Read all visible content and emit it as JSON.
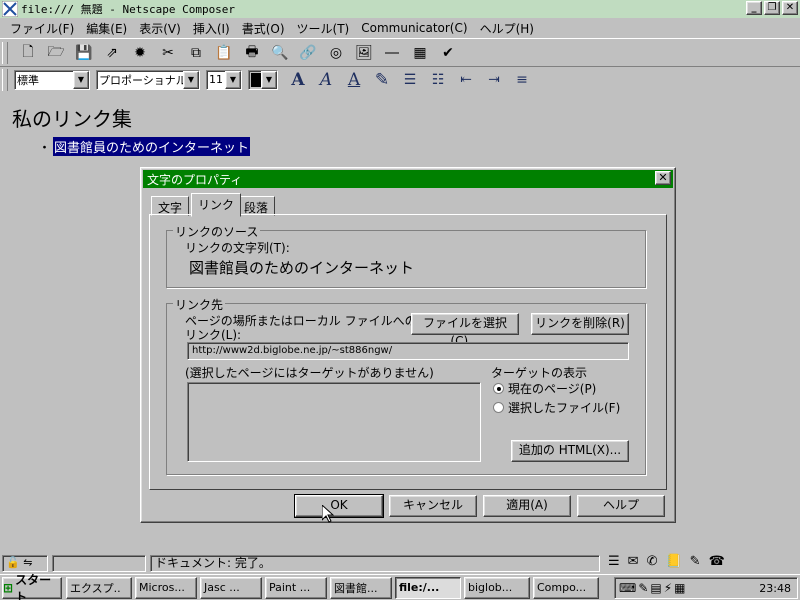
{
  "window": {
    "title": "file:/// 無題 - Netscape Composer"
  },
  "menubar": {
    "items": [
      "ファイル(F)",
      "編集(E)",
      "表示(V)",
      "挿入(I)",
      "書式(O)",
      "ツール(T)",
      "Communicator(C)",
      "ヘルプ(H)"
    ]
  },
  "format_bar": {
    "paragraph_style": "標準",
    "font": "プロポーショナル",
    "font_size": "11",
    "text_color": "#000000"
  },
  "document": {
    "heading": "私のリンク集",
    "bullet": "・",
    "link_text": "図書館員のためのインターネット"
  },
  "dialog": {
    "title": "文字のプロパティ",
    "tabs": [
      "文字",
      "リンク",
      "段落"
    ],
    "active_tab": "リンク",
    "source_group": "リンクのソース",
    "source_label": "リンクの文字列(T):",
    "source_text": "図書館員のためのインターネット",
    "dest_group": "リンク先",
    "dest_label_1": "ページの場所またはローカル ファイルへの",
    "dest_label_2": "リンク(L):",
    "choose_file": "ファイルを選択(C)...",
    "remove_link": "リンクを削除(R)",
    "url": "http://www2d.biglobe.ne.jp/~st886ngw/",
    "targets_label": "(選択したページにはターゲットがありません)",
    "show_targets": "ターゲットの表示",
    "radio_current": "現在のページ(P)",
    "radio_selected": "選択したファイル(F)",
    "extra_html": "追加の HTML(X)...",
    "ok": "OK",
    "cancel": "キャンセル",
    "apply": "適用(A)",
    "help": "ヘルプ"
  },
  "statusbar": {
    "text": "ドキュメント: 完了。"
  },
  "taskbar": {
    "start": "スタート",
    "tasks": [
      "エクスプ..",
      "Micros...",
      "Jasc ...",
      "Paint ...",
      "図書館...",
      "file:/...",
      "biglob...",
      "Compo..."
    ],
    "active_task": 5,
    "clock": "23:48"
  },
  "colors": {
    "titlebar": "#c0dcc0",
    "dialog_title": "#008000",
    "selection": "#000080",
    "face": "#c0c0c0"
  }
}
